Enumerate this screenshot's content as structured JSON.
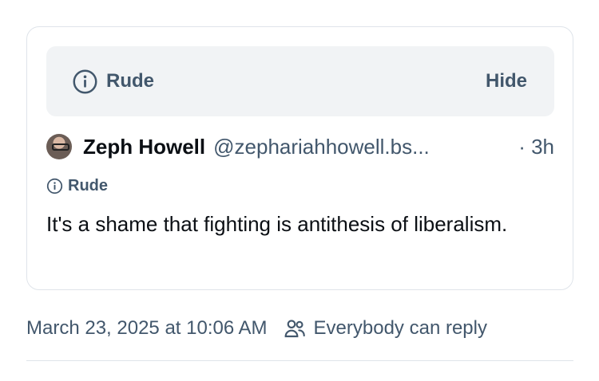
{
  "quote": {
    "warning": {
      "label": "Rude",
      "hide_label": "Hide",
      "icon": "info-circle-icon"
    },
    "author": {
      "name": "Zeph Howell",
      "handle": "@zephariahhowell.bs...",
      "time": "· 3h",
      "avatar": "avatar"
    },
    "inline_label": "Rude",
    "text": "It's a shame that fighting is antithesis of liberalism."
  },
  "meta": {
    "date": "March 23, 2025 at 10:06 AM",
    "reply_setting": "Everybody can reply",
    "reply_icon": "people-icon"
  },
  "colors": {
    "muted_text": "#42576c",
    "warning_bg": "#f1f3f5",
    "border": "#dfe4ea"
  }
}
